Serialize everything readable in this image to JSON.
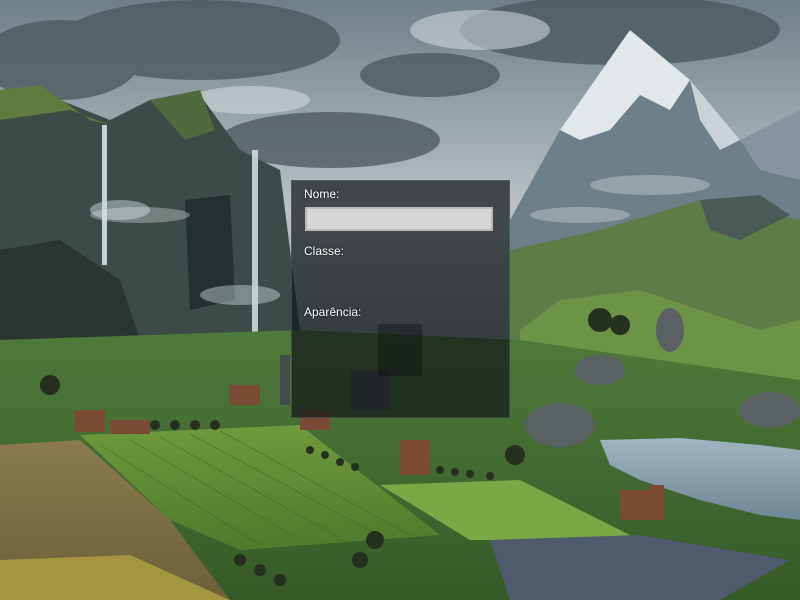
{
  "scene": {
    "icon": "landscape-background"
  },
  "form": {
    "name_label": "Nome:",
    "name_value": "",
    "class_label": "Classe:",
    "appearance_label": "Aparência:"
  },
  "colors": {
    "panel_bg": "#14181a",
    "input_bg": "#d6d6d6",
    "label_text": "#ffffff"
  }
}
